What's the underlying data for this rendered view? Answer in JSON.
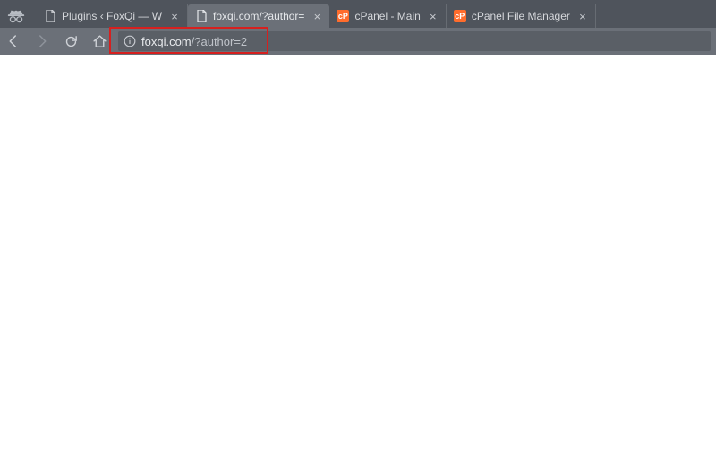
{
  "tabs": [
    {
      "title": "Plugins ‹ FoxQi — W",
      "favicon": "generic"
    },
    {
      "title": "foxqi.com/?author=",
      "favicon": "generic"
    },
    {
      "title": "cPanel - Main",
      "favicon": "cp",
      "favlabel": "cP"
    },
    {
      "title": "cPanel File Manager",
      "favicon": "cp",
      "favlabel": "cP"
    }
  ],
  "activeTabIndex": 1,
  "url": {
    "host": "foxqi.com",
    "path": "/?author=2"
  }
}
